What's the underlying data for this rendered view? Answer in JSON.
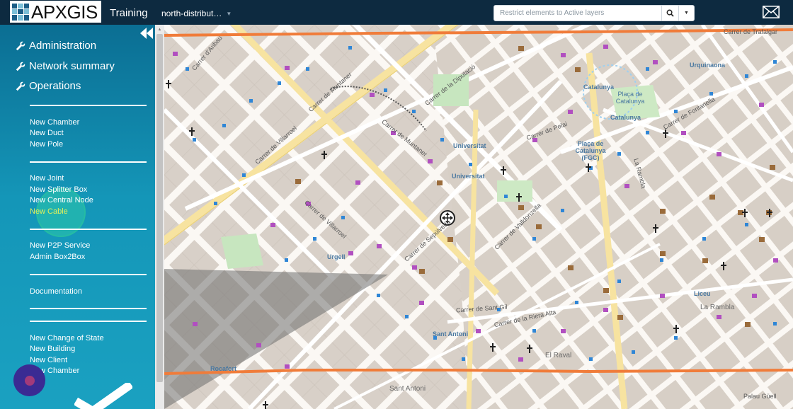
{
  "header": {
    "logo_text": "APXGIS",
    "app_title": "Training",
    "project": "north-distribut…",
    "search": {
      "placeholder": "Restrict elements to Active layers"
    },
    "icons": [
      "search-icon",
      "caret-down-icon",
      "mail-icon"
    ]
  },
  "sidebar": {
    "sections": [
      {
        "label": "Administration"
      },
      {
        "label": "Network summary"
      },
      {
        "label": "Operations"
      }
    ],
    "groups": [
      [
        "New Chamber",
        "New Duct",
        "New Pole"
      ],
      [
        "New Joint",
        "New Splitter Box",
        "New Central Node",
        "New Cable"
      ],
      [
        "New P2P Service",
        "Admin Box2Box"
      ],
      [
        "Documentation"
      ],
      [
        "New Change of State",
        "New Building",
        "New Client",
        "New Chamber"
      ]
    ],
    "active_item": "New Cable"
  },
  "map": {
    "labels": {
      "street_1": "Carrer d'Aribau",
      "street_2": "Carrer de Muntaner",
      "street_3": "Carrer de Pelai",
      "street_4": "Carrer de Sepúlveda",
      "street_5": "Carrer de la Diputació",
      "street_6": "Carrer de Villarroel",
      "street_7": "Carrer de Valldonzella",
      "street_8": "Carrer de Sant Gil",
      "street_9": "Carrer de la Riera Alta",
      "street_10": "Carrer de Trafalgar",
      "street_11": "La Rambla",
      "street_12": "Carrer de Fontanella",
      "place_1": "Universitat",
      "place_2": "Universitat",
      "place_3": "Catalunya",
      "place_4": "Plaça de Catalunya",
      "place_5": "Catalunya",
      "place_6": "Plaça de Catalunya (FGC)",
      "place_7": "Urgell",
      "place_8": "Sant Antoni",
      "place_9": "Sant Antoni",
      "place_10": "Rocafort",
      "place_11": "El Raval",
      "place_12": "Liceu",
      "place_13": "La Rambla",
      "place_14": "Urquinaona",
      "place_15": "Palau Güell"
    },
    "colors": {
      "cable": "#f07c3a",
      "block": "#d9d1c9",
      "road_major": "#f7e3a0",
      "road": "#ffffff",
      "poi_purple": "#b14fc0",
      "chamber_blue": "#2f86d6",
      "polygon": "#6e6e6e"
    }
  }
}
